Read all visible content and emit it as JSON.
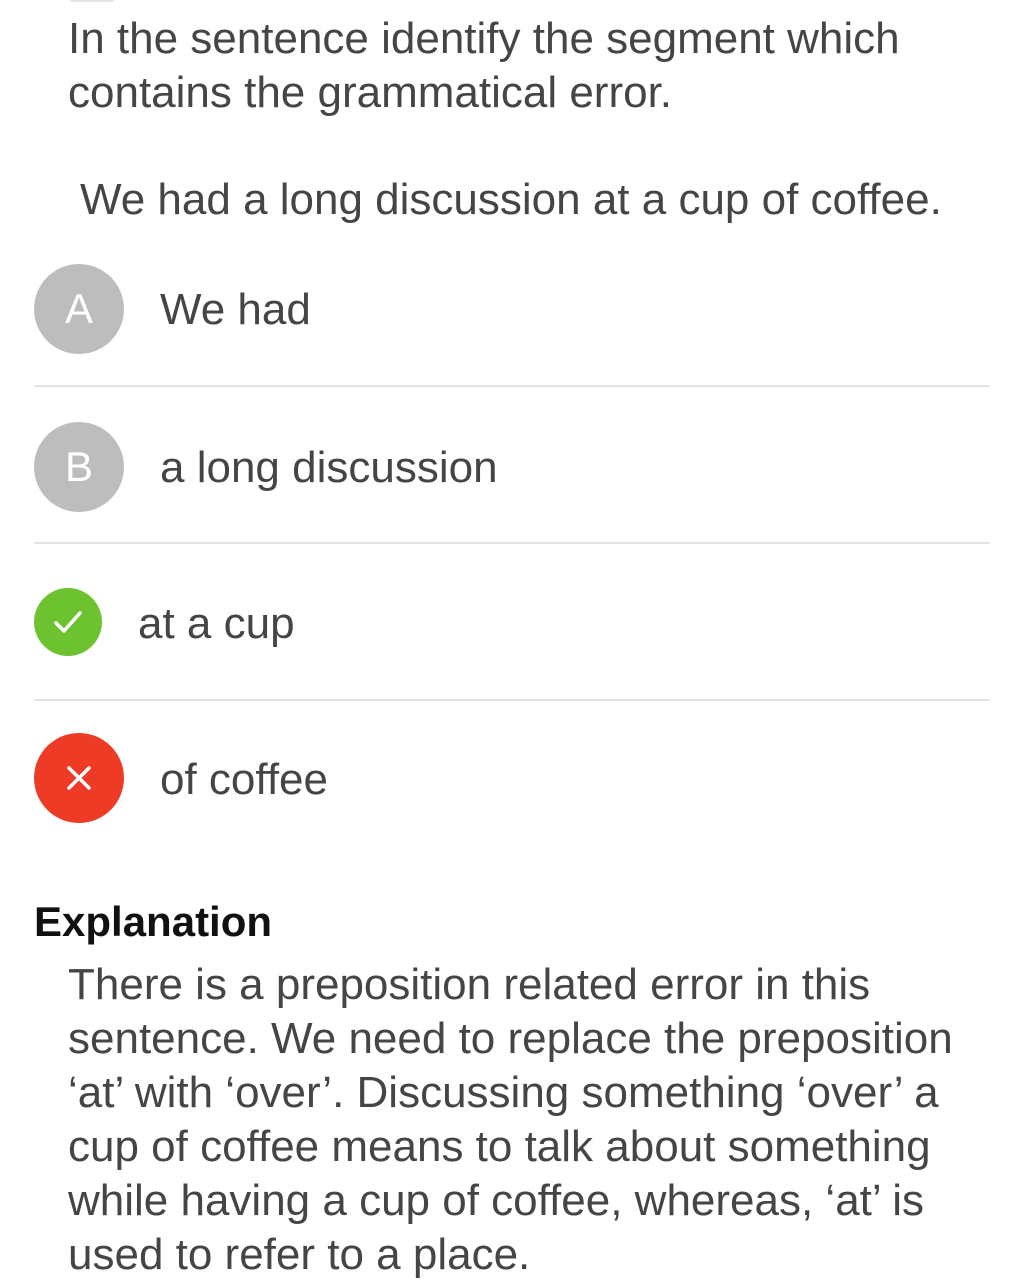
{
  "question": {
    "prompt": "In the sentence identify the segment which contains the grammatical error.",
    "sentence": "We had a long discussion at a cup of coffee."
  },
  "options": [
    {
      "badge": "A",
      "state": "unselected",
      "text": "We had"
    },
    {
      "badge": "B",
      "state": "unselected",
      "text": "a long discussion"
    },
    {
      "badge": "check-icon",
      "state": "correct",
      "text": "at a cup"
    },
    {
      "badge": "close-icon",
      "state": "wrong",
      "text": "of coffee"
    }
  ],
  "explanation": {
    "title": "Explanation",
    "body": "There is a preposition related error in this sentence. We need to replace the preposition ‘at’ with ‘over’. Discussing something ‘over’ a cup of coffee means to talk about something while having a cup of coffee, whereas, ‘at’ is used to refer to a place."
  },
  "colors": {
    "correct": "#6cc32f",
    "wrong": "#ee3b26",
    "neutral_badge": "#bdbdbd",
    "text": "#454545"
  }
}
